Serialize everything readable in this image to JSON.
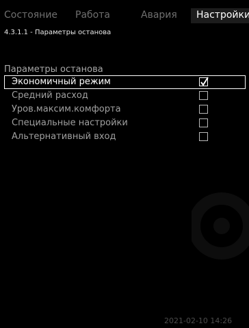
{
  "tabs": [
    {
      "label": "Состояние",
      "active": false
    },
    {
      "label": "Работа",
      "active": false
    },
    {
      "label": "Авария",
      "active": false
    },
    {
      "label": "Настройки",
      "active": true
    }
  ],
  "breadcrumb": "4.3.1.1 - Параметры останова",
  "section_title": "Параметры останова",
  "options": [
    {
      "label": "Экономичный режим",
      "checked": true,
      "selected": true
    },
    {
      "label": "Средний расход",
      "checked": false,
      "selected": false
    },
    {
      "label": "Уров.максим.комфорта",
      "checked": false,
      "selected": false
    },
    {
      "label": "Специальные настройки",
      "checked": false,
      "selected": false
    },
    {
      "label": "Альтернативный вход",
      "checked": false,
      "selected": false
    }
  ],
  "timestamp": "2021-02-10 14:26",
  "watermark_icon": "logo-watermark-icon",
  "colors": {
    "background": "#000000",
    "active_tab_bg": "#1c1c1c",
    "inactive_text": "#6f6f6f",
    "option_text": "#a0a0a0",
    "selected_text": "#ffffff"
  }
}
